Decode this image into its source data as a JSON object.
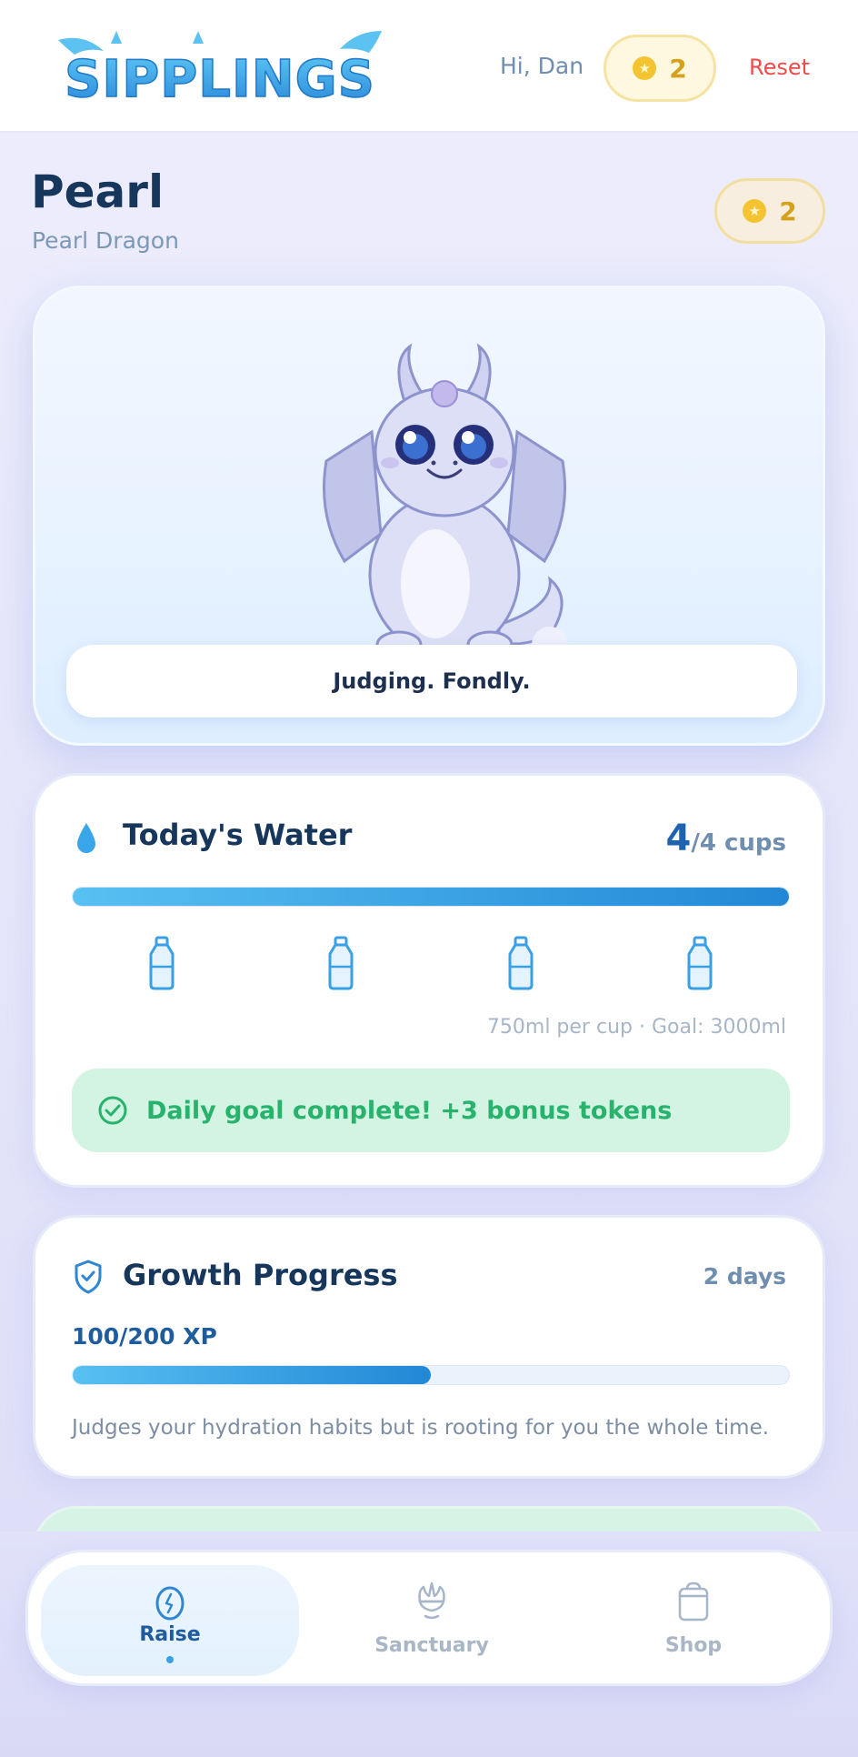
{
  "header": {
    "logo_text": "SIPPLINGS",
    "greeting": "Hi, Dan",
    "tokens": "2",
    "reset_label": "Reset"
  },
  "pet": {
    "name": "Pearl",
    "species": "Pearl Dragon",
    "tokens": "2",
    "quote": "Judging. Fondly."
  },
  "water": {
    "title": "Today's Water",
    "cups_done": "4",
    "cups_total_label": "/4 cups",
    "progress": 1.0,
    "cups": [
      {
        "icon": "bottle-icon",
        "filled": true
      },
      {
        "icon": "bottle-icon",
        "filled": true
      },
      {
        "icon": "bottle-icon",
        "filled": true
      },
      {
        "icon": "bottle-icon",
        "filled": true
      }
    ],
    "meta": "750ml per cup · Goal: 3000ml",
    "goal_message": "Daily goal complete! +3 bonus tokens"
  },
  "growth": {
    "title": "Growth Progress",
    "days": "2 days",
    "xp_label": "100/200 XP",
    "progress": 0.5,
    "description": "Judges your hydration habits but is rooting for you the whole time."
  },
  "nav": {
    "items": [
      {
        "label": "Raise",
        "icon": "egg-icon",
        "active": true
      },
      {
        "label": "Sanctuary",
        "icon": "sanctuary-icon",
        "active": false
      },
      {
        "label": "Shop",
        "icon": "bag-icon",
        "active": false
      }
    ]
  },
  "colors": {
    "accent": "#2288d6",
    "token": "#d6a11a",
    "success": "#27b36c",
    "danger": "#ee4b4b"
  }
}
